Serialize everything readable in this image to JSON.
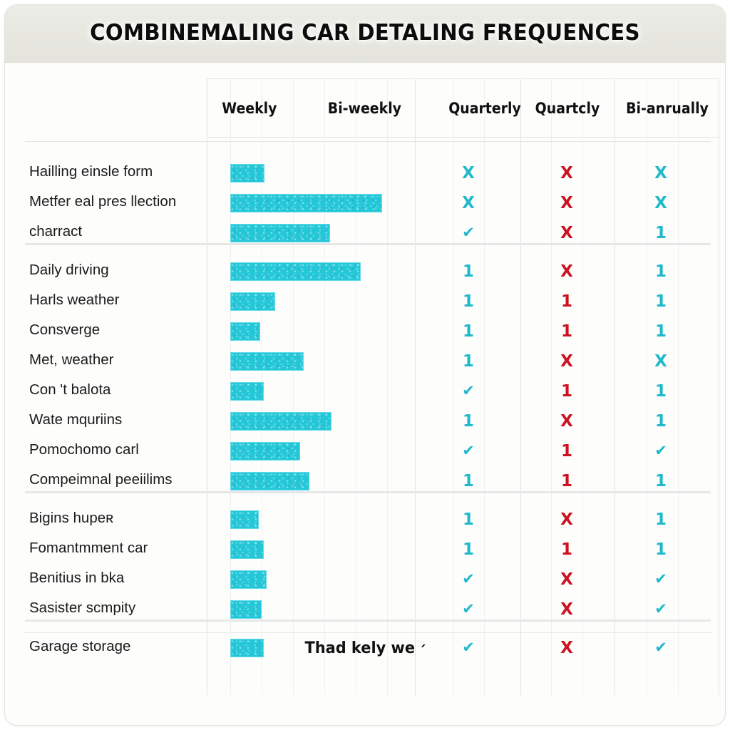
{
  "chart_data": {
    "type": "bar",
    "title": "COMBINEMΔLING CAR DETALING FREQUENCES",
    "footer_note": "Thad kely we ׳",
    "xlabel": "",
    "ylabel": "",
    "grid": true,
    "legend": "none",
    "bar_color": "#24c7d8",
    "check_color": "#1fb9cc",
    "cross_color": "#cc1220",
    "columns": [
      {
        "label": "Weekly",
        "type": "bar-axis"
      },
      {
        "label": "Bi-weekly",
        "type": "bar-axis"
      },
      {
        "label": "Quarterly",
        "type": "symbol"
      },
      {
        "label": "Quartcly",
        "type": "symbol"
      },
      {
        "label": "Bi-anrually",
        "type": "symbol"
      }
    ],
    "axis_max": 230,
    "groups": [
      {
        "rows": [
          {
            "label": "Hailling einsle form",
            "value": 32,
            "quarterly": "X",
            "quartcly": "X",
            "biannually": "X"
          },
          {
            "label": "Metfer eal pres llection",
            "value": 209,
            "quarterly": "X",
            "quartcly": "X",
            "biannually": "X"
          },
          {
            "label": "charract",
            "value": 130,
            "quarterly": "✔",
            "quartcly": "X",
            "biannually": "1"
          }
        ]
      },
      {
        "rows": [
          {
            "label": "Daily driving",
            "value": 177,
            "quarterly": "1",
            "quartcly": "X",
            "biannually": "1"
          },
          {
            "label": "Harls weather",
            "value": 48,
            "quarterly": "1",
            "quartcly": "1",
            "biannually": "1"
          },
          {
            "label": "Consverge",
            "value": 26,
            "quarterly": "1",
            "quartcly": "1",
            "biannually": "1"
          },
          {
            "label": "Met, weather",
            "value": 91,
            "quarterly": "1",
            "quartcly": "X",
            "biannually": "X"
          },
          {
            "label": "Con 't balota",
            "value": 31,
            "quarterly": "✔",
            "quartcly": "1",
            "biannually": "1"
          },
          {
            "label": "Wate mquriins",
            "value": 133,
            "quarterly": "1",
            "quartcly": "X",
            "biannually": "1"
          },
          {
            "label": "Pomochomo carl",
            "value": 86,
            "quarterly": "✔",
            "quartcly": "1",
            "biannually": "✔"
          },
          {
            "label": "Compeimnal peeiilims",
            "value": 99,
            "quarterly": "1",
            "quartcly": "1",
            "biannually": "1"
          }
        ]
      },
      {
        "rows": [
          {
            "label": "Bigins hupeʀ",
            "value": 24,
            "quarterly": "1",
            "quartcly": "X",
            "biannually": "1"
          },
          {
            "label": "Fomantmment car",
            "value": 31,
            "quarterly": "1",
            "quartcly": "1",
            "biannually": "1"
          },
          {
            "label": "Benitius in bka",
            "value": 35,
            "quarterly": "✔",
            "quartcly": "X",
            "biannually": "✔"
          },
          {
            "label": "Sasister scmpity",
            "value": 28,
            "quarterly": "✔",
            "quartcly": "X",
            "biannually": "✔"
          }
        ]
      },
      {
        "rows": [
          {
            "label": "Garage storage",
            "value": 31,
            "quarterly": "✔",
            "quartcly": "X",
            "biannually": "✔"
          }
        ]
      }
    ]
  }
}
